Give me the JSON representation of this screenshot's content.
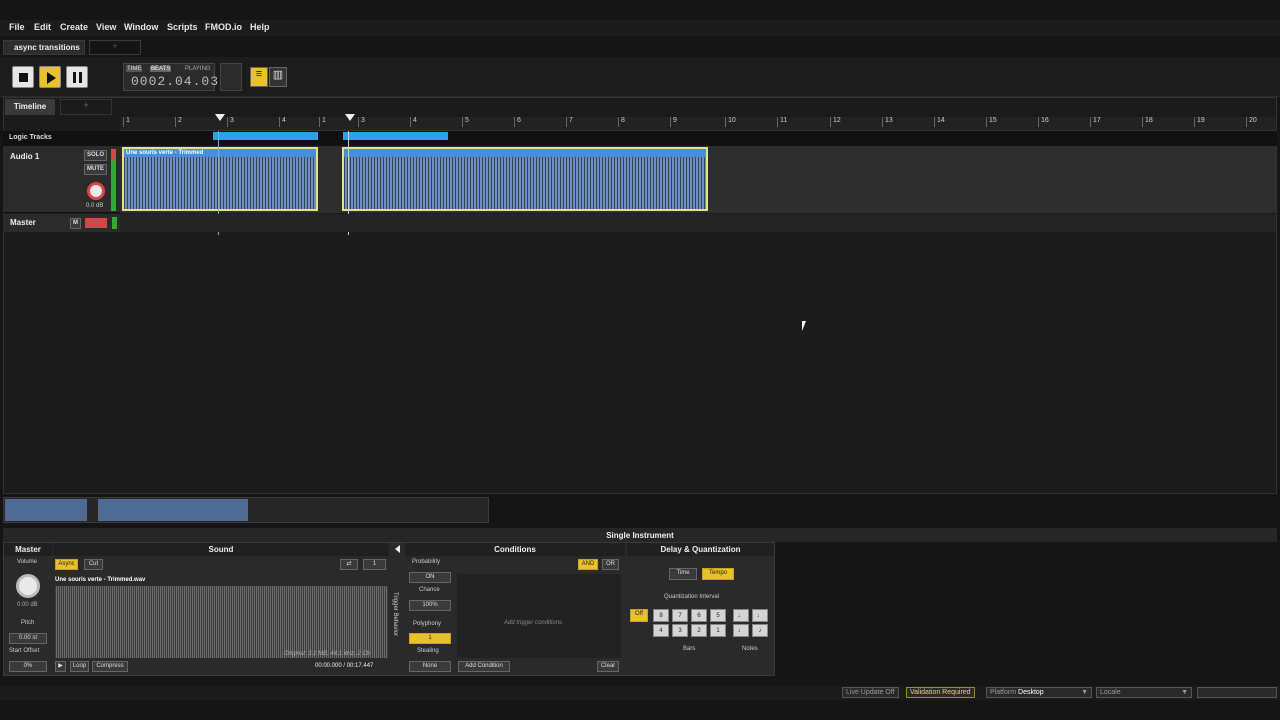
{
  "menu": {
    "items": [
      "File",
      "Edit",
      "Create",
      "View",
      "Window",
      "Scripts",
      "FMOD.io",
      "Help"
    ]
  },
  "doc_tab": {
    "label": "async transitions",
    "add": "+"
  },
  "transport": {
    "time_label": "TIME",
    "beats_label": "BEATS",
    "state": "PLAYING",
    "position": "0002.04.03"
  },
  "editor": {
    "timeline_tab": "Timeline",
    "add_tab": "+",
    "logic_tracks": "Logic Tracks",
    "ruler_ticks": [
      "1",
      "2",
      "3",
      "4",
      "1",
      "3",
      "4",
      "5",
      "6",
      "7",
      "8",
      "9",
      "10",
      "11",
      "12",
      "13",
      "14",
      "15",
      "16",
      "17",
      "18",
      "19",
      "20"
    ],
    "track": {
      "name": "Audio 1",
      "solo": "SOLO",
      "mute": "MUTE",
      "volume": "0.0 dB",
      "instrument": "Une souris verte - Trimmed"
    },
    "master": {
      "name": "Master",
      "m": "M"
    }
  },
  "deck": {
    "title": "Single Instrument",
    "master": "Master",
    "sound": "Sound",
    "conditions": "Conditions",
    "delay": "Delay & Quantization",
    "volume_label": "Volume",
    "volume": "0.00 dB",
    "pitch_label": "Pitch",
    "pitch": "0.00 st",
    "start_offset_label": "Start Offset",
    "start_offset": "0%",
    "async": "Async",
    "cut": "Cut",
    "loop_count": "1",
    "filename": "Une souris verte - Trimmed.wav",
    "file_info": "Original: 3.1 MB, 44.1 kHz, 2 Ch",
    "loop": "Loop",
    "compress": "Compress",
    "time": "00:00.000 / 00:17.447",
    "trigger_behavior": "Trigger Behavior",
    "probability": "Probability",
    "prob_on": "ON",
    "chance": "Chance",
    "chance_val": "100%",
    "polyphony": "Polyphony",
    "polyphony_val": "1",
    "stealing": "Stealing",
    "stealing_val": "None",
    "and": "AND",
    "or": "OR",
    "add_trigger": "Add trigger conditions",
    "add_condition": "Add Condition",
    "clear": "Clear",
    "time_btn": "Time",
    "tempo_btn": "Tempo",
    "quant_interval": "Quantization Interval",
    "off": "Off",
    "bars_top": [
      "8",
      "7",
      "6",
      "5"
    ],
    "bars_bottom": [
      "4",
      "3",
      "2",
      "1"
    ],
    "bars": "Bars",
    "notes": "Notes"
  },
  "status": {
    "live_update": "Live Update Off",
    "validation": "Validation Required",
    "platform_label": "Platform",
    "platform": "Desktop",
    "locale_label": "Locale"
  },
  "colors": {
    "accent": "#e7c22a",
    "instrument": "#4a8ce0",
    "logic": "#2ca3e8"
  }
}
